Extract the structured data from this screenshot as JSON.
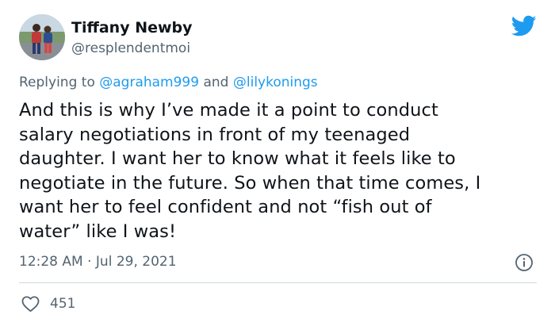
{
  "author": {
    "display_name": "Tiffany Newby",
    "handle": "@resplendentmoi"
  },
  "reply": {
    "prefix": "Replying to",
    "mention_1": "@agraham999",
    "joiner": "and",
    "mention_2": "@lilykonings"
  },
  "tweet": {
    "lines": [
      "And this is why I’ve made it a point to conduct",
      "salary negotiations in front of my teenaged",
      "daughter. I want her to know what it feels like to",
      "negotiate in the future. So when that time comes, I",
      "want her to feel confident and not “fish out of",
      "water” like I was!"
    ],
    "timestamp": "12:28 AM · Jul 29, 2021",
    "likes": "451"
  },
  "icons": {
    "brand": "twitter-bird-icon",
    "info": "info-icon",
    "like": "heart-icon"
  },
  "colors": {
    "brand_blue": "#1d9bf0",
    "text_primary": "#0f1419",
    "text_secondary": "#536471",
    "divider": "#cfd9de"
  }
}
